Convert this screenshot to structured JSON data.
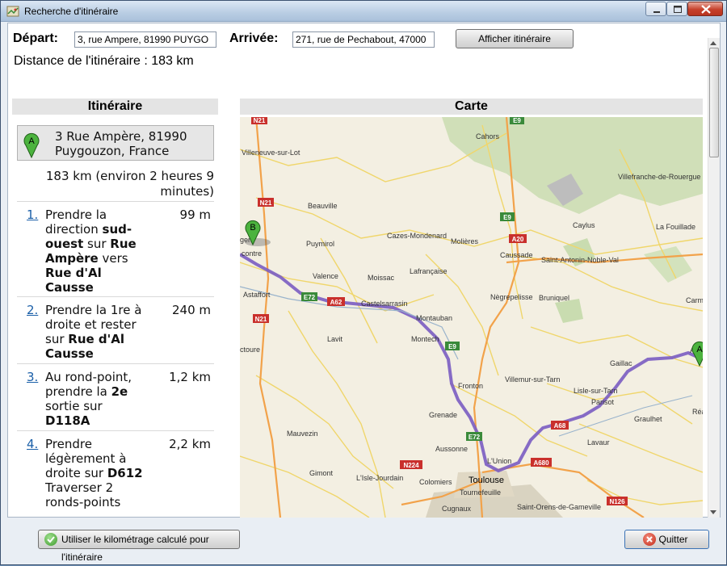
{
  "window": {
    "title": "Recherche d'itinéraire"
  },
  "form": {
    "depart_label": "Départ:",
    "depart_value": "3, rue Ampere, 81990 PUYGO",
    "arrivee_label": "Arrivée:",
    "arrivee_value": "271, rue de Pechabout, 47000",
    "show_button": "Afficher itinéraire"
  },
  "distance_text": "Distance de l'itinéraire : 183 km",
  "headers": {
    "itinerary": "Itinéraire",
    "map": "Carte"
  },
  "itinerary": {
    "start_line1": "3 Rue Ampère, 81990",
    "start_line2": "Puygouzon, France",
    "start_marker": "A",
    "summary_line1": "183 km (environ 2 heures 9",
    "summary_line2": "minutes)",
    "steps": [
      {
        "num": "1.",
        "dist": "99 m"
      },
      {
        "num": "2.",
        "dist": "240 m"
      },
      {
        "num": "3.",
        "dist": "1,2 km"
      },
      {
        "num": "4.",
        "dist": "2,2 km"
      }
    ],
    "step_texts": {
      "s1a": "Prendre la direction ",
      "s1b": "sud-ouest",
      "s1c": " sur ",
      "s1d": "Rue Ampère",
      "s1e": " vers ",
      "s1f": "Rue d'Al Causse",
      "s2a": "Prendre la 1re à droite et rester sur ",
      "s2b": "Rue d'Al Causse",
      "s3a": "Au rond-point, prendre la ",
      "s3b": "2e",
      "s3c": " sortie sur ",
      "s3d": "D118A",
      "s4a": "Prendre légèrement à droite sur ",
      "s4b": "D612",
      "s4c": "Traverser 2 ronds-points"
    }
  },
  "map": {
    "marker_b": "B",
    "marker_a": "A",
    "places": {
      "cahors": "Cahors",
      "villeneuve": "Villeneuve-sur-Lot",
      "beauville": "Beauville",
      "puymirol": "Puymirol",
      "valence": "Valence",
      "moissac": "Moissac",
      "astaffort": "Astaffort",
      "lavit": "Lavit",
      "castelsarrasin": "Castelsarrasin",
      "montauban": "Montauban",
      "montech": "Montech",
      "lafrancaise": "Lafrançaise",
      "cazes": "Cazes-Mondenard",
      "molieres": "Molières",
      "caussade": "Caussade",
      "caylus": "Caylus",
      "lafouillade": "La Fouillade",
      "villefranche": "Villefranche-de-Rouergue",
      "saint_antonin": "Saint-Antonin-Noble-Val",
      "negrepelisse": "Nègrepelisse",
      "bruniquel": "Bruniquel",
      "gaillac": "Gaillac",
      "lisle": "Lisle-sur-Tarn",
      "parisot": "Parisot",
      "graulhet": "Graulhet",
      "lavaur": "Lavaur",
      "villemur": "Villemur-sur-Tarn",
      "fronton": "Fronton",
      "grenade": "Grenade",
      "aussonne": "Aussonne",
      "lunion": "L'Union",
      "toulouse": "Toulouse",
      "colomiers": "Colomiers",
      "tournefeuille": "Tournefeuille",
      "cugnaux": "Cugnaux",
      "lisle_jourdain": "L'Isle-Jourdain",
      "gimont": "Gimont",
      "saint_orens": "Saint-Orens-de-Gameville",
      "mauvezin": "Mauvezin",
      "ctoure": "ctoure",
      "contre": "contre",
      "carm": "Carm",
      "ages": "gen",
      "al": "Al",
      "rea": "Réa"
    },
    "roads": {
      "n21a": "N21",
      "n21b": "N21",
      "n21c": "N21",
      "e72a": "E72",
      "a62": "A62",
      "e9a": "E9",
      "e9b": "E9",
      "a20": "A20",
      "e72b": "E72",
      "a68": "A68",
      "a680": "A680",
      "n224": "N224",
      "n126": "N126",
      "e9_top": "E9"
    }
  },
  "footer": {
    "km_button": "Utiliser le kilométrage calculé pour l'itinéraire",
    "quit_button": "Quitter"
  }
}
